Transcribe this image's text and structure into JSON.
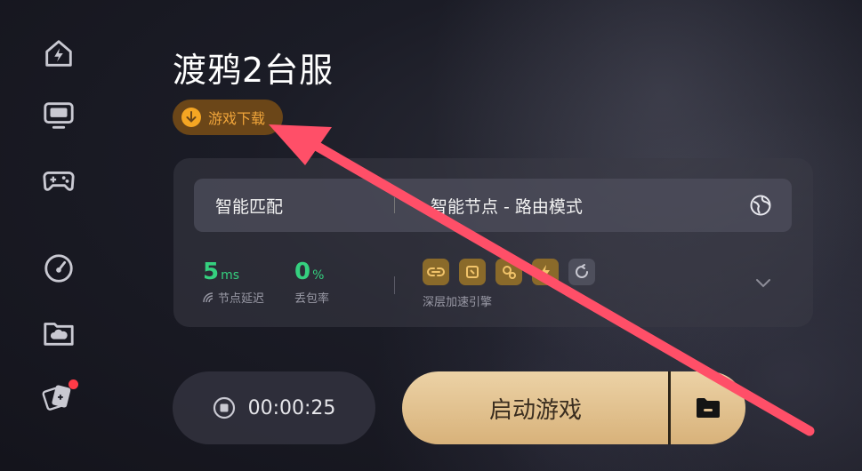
{
  "sidebar": {
    "items": [
      {
        "name": "home-boost-icon"
      },
      {
        "name": "monitor-icon"
      },
      {
        "name": "gamepad-icon"
      },
      {
        "name": "speedometer-icon"
      },
      {
        "name": "cloud-folder-icon"
      },
      {
        "name": "game-cards-icon",
        "badge": true
      }
    ]
  },
  "game": {
    "title": "渡鸦2台服",
    "download_label": "游戏下载"
  },
  "node": {
    "match_label": "智能匹配",
    "mode_label": "智能节点 - 路由模式"
  },
  "stats": {
    "latency_value": "5",
    "latency_unit": "ms",
    "latency_label": "节点延迟",
    "loss_value": "0",
    "loss_unit": "%",
    "loss_label": "丢包率"
  },
  "engine": {
    "label": "深层加速引擎",
    "icons": [
      "link-icon",
      "chip-icon",
      "gear-icon",
      "lightning-icon",
      "refresh-icon"
    ]
  },
  "controls": {
    "timer": "00:00:25",
    "launch_label": "启动游戏"
  },
  "colors": {
    "accent_green": "#35d07f",
    "launch_gold": "#e3c291",
    "download_orange": "#f5a623",
    "annotation_red": "#ff4f68"
  }
}
